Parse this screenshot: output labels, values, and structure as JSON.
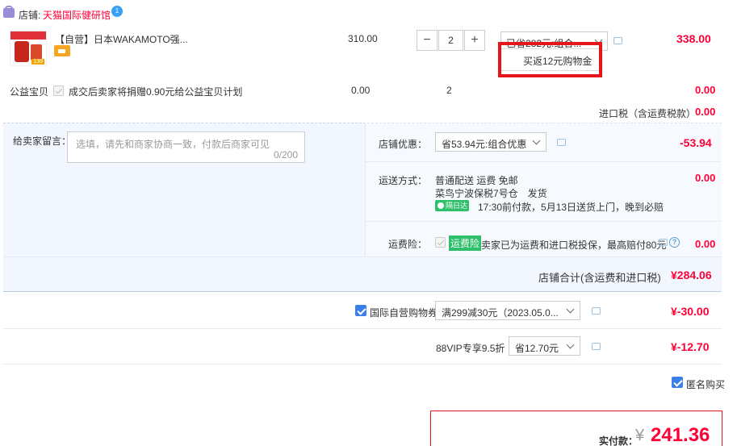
{
  "shop": {
    "label": "店铺:",
    "name": "天猫国际健研馆",
    "badge": "1"
  },
  "product": {
    "title": "【自营】日本WAKAMOTO强...",
    "thumb_badge": "139",
    "price": "310.00",
    "quantity": "2",
    "qty_minus": "−",
    "qty_plus": "+",
    "discount_select": "已省282元:组合...",
    "discount_tooltip": "买返12元购物金",
    "subtotal": "338.00"
  },
  "charity": {
    "label": "公益宝贝",
    "text": "成交后卖家将捐赠0.90元给公益宝贝计划",
    "price": "0.00",
    "quantity": "2",
    "subtotal": "0.00"
  },
  "import_tax": {
    "label": "进口税（含运费税款）",
    "value": "0.00"
  },
  "seller_message": {
    "label": "给卖家留言：",
    "placeholder": "选填，请先和商家协商一致，付款后商家可见",
    "counter": "0/200"
  },
  "shop_discount": {
    "label": "店铺优惠：",
    "select": "省53.94元:组合优惠",
    "value": "-53.94"
  },
  "shipping": {
    "label": "运送方式：",
    "method": "普通配送 运费 免邮",
    "warehouse": "菜鸟宁波保税7号仓　发货",
    "next_day_badge": "隔日达",
    "delivery_note": "17:30前付款，5月13日送货上门，晚到必赔",
    "value": "0.00"
  },
  "insurance": {
    "label": "运费险：",
    "tag": "运费险",
    "text": "卖家已为运费和进口税投保，最高赔付80元",
    "value": "0.00"
  },
  "shop_total": {
    "label": "店铺合计(含运费和进口税)",
    "value": "¥284.06"
  },
  "coupon": {
    "label": "国际自营购物券",
    "select": "满299减30元（2023.05.0...",
    "value": "¥-30.00"
  },
  "vip": {
    "label": "88VIP专享9.5折",
    "select": "省12.70元",
    "value": "¥-12.70"
  },
  "anonymous": {
    "label": "匿名购买"
  },
  "payment": {
    "label": "实付款：",
    "currency": "¥",
    "amount": "241.36"
  },
  "colors": {
    "accent_red": "#ff0036",
    "highlight_box": "#e8141c",
    "band_blue": "#f2f7ff",
    "checkbox_blue": "#3d7fe8",
    "badge_green": "#2ebf6a"
  }
}
